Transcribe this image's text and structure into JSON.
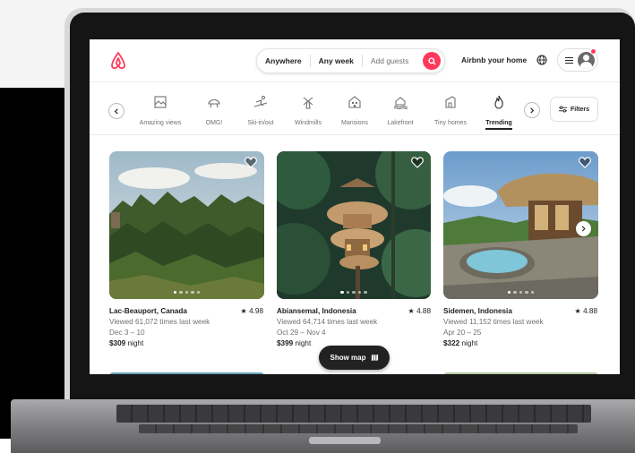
{
  "header": {
    "search": {
      "location": "Anywhere",
      "dates": "Any week",
      "guests": "Add guests"
    },
    "host_link": "Airbnb your home",
    "brand_color": "#ff385c"
  },
  "categories": [
    {
      "label": "Amazing views",
      "icon": "amazing-views-icon",
      "active": false
    },
    {
      "label": "OMG!",
      "icon": "omg-icon",
      "active": false
    },
    {
      "label": "Ski-in/out",
      "icon": "ski-icon",
      "active": false
    },
    {
      "label": "Windmills",
      "icon": "windmill-icon",
      "active": false
    },
    {
      "label": "Mansions",
      "icon": "mansion-icon",
      "active": false
    },
    {
      "label": "Lakefront",
      "icon": "lakefront-icon",
      "active": false
    },
    {
      "label": "Tiny homes",
      "icon": "tiny-home-icon",
      "active": false
    },
    {
      "label": "Trending",
      "icon": "trending-flame-icon",
      "active": true
    }
  ],
  "filters_label": "Filters",
  "listings": [
    {
      "location": "Lac-Beauport, Canada",
      "rating": "4.98",
      "views": "Viewed 61,072 times last week",
      "dates": "Dec 3 – 10",
      "price": "$309",
      "price_unit": " night"
    },
    {
      "location": "Abiansemal, Indonesia",
      "rating": "4.88",
      "views": "Viewed 64,714 times last week",
      "dates": "Oct 29 – Nov 4",
      "price": "$399",
      "price_unit": " night"
    },
    {
      "location": "Sidemen, Indonesia",
      "rating": "4.88",
      "views": "Viewed 11,152 times last week",
      "dates": "Apr 20 – 25",
      "price": "$322",
      "price_unit": " night"
    }
  ],
  "show_map_label": "Show map"
}
